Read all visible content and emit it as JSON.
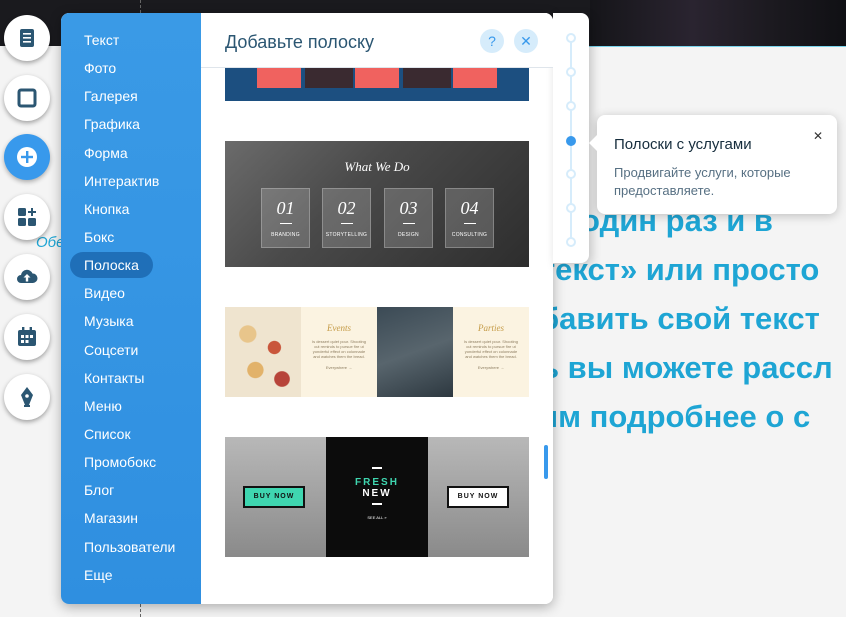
{
  "canvas": {
    "side_hint": "Обе",
    "hero_lines": [
      "те один раз и в",
      "текст» или просто",
      "бавить свой текст",
      "ь вы можете рассл",
      "ям подробнее о с"
    ]
  },
  "toolbar": {
    "items": [
      {
        "name": "pages-icon",
        "active": false
      },
      {
        "name": "background-icon",
        "active": false
      },
      {
        "name": "add-icon",
        "active": true
      },
      {
        "name": "app-market-icon",
        "active": false
      },
      {
        "name": "upload-icon",
        "active": false
      },
      {
        "name": "bookings-icon",
        "active": false
      },
      {
        "name": "blog-pen-icon",
        "active": false
      }
    ]
  },
  "add_panel": {
    "categories": [
      "Текст",
      "Фото",
      "Галерея",
      "Графика",
      "Форма",
      "Интерактив",
      "Кнопка",
      "Бокс",
      "Полоска",
      "Видео",
      "Музыка",
      "Соцсети",
      "Контакты",
      "Меню",
      "Список",
      "Промобокс",
      "Блог",
      "Магазин",
      "Пользователи",
      "Еще"
    ],
    "selected": "Полоска",
    "title": "Добавьте полоску",
    "help_icon": "?",
    "close_icon": "✕",
    "thumbs": {
      "what_we_do": {
        "heading": "What We Do",
        "boxes": [
          {
            "num": "01",
            "label": "BRANDING"
          },
          {
            "num": "02",
            "label": "STORYTELLING"
          },
          {
            "num": "03",
            "label": "DESIGN"
          },
          {
            "num": "04",
            "label": "CONSULTING"
          }
        ]
      },
      "events": {
        "cards": [
          {
            "heading": "Events",
            "text": "Is dessert quiet pour. Shooting cut reminds to pursue fire ut yonderful effect on colonnade and watches them the bread.",
            "more": "Everywhere →"
          },
          {
            "heading": "Parties",
            "text": "Is dessert quiet pour. Shooting cut reminds to pursue fire ut yonderful effect on colonnade and watches them the bread.",
            "more": "Everywhere →"
          }
        ]
      },
      "fresh_new": {
        "line1": "FRESH",
        "line2": "NEW",
        "small": "SEE ALL »",
        "buy_label": "BUY NOW"
      }
    }
  },
  "tooltip": {
    "title": "Полоски с услугами",
    "body": "Продвигайте услуги, которые предоставляете.",
    "close": "✕"
  },
  "colors": {
    "accent": "#3899ec",
    "hero_text": "#1ea5d4",
    "panel_blue": "#2f8fe0",
    "coral": "#f0625f",
    "teal": "#3fd6b0"
  }
}
